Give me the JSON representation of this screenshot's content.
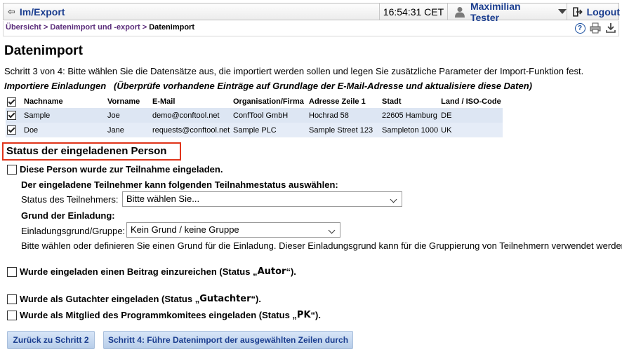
{
  "topbar": {
    "section_label": "Im/Export",
    "time": "16:54:31 CET",
    "user_name": "Maximilian Tester",
    "logout_label": "Logout"
  },
  "breadcrumb": {
    "items": [
      "Übersicht",
      "Datenimport und -export"
    ],
    "sep": ">",
    "current": "Datenimport"
  },
  "page": {
    "title": "Datenimport",
    "step_text": "Schritt 3 von 4: Bitte wählen Sie die Datensätze aus, die importiert werden sollen und legen Sie zusätzliche Parameter der Import-Funktion fest.",
    "import_title": "Importiere Einladungen   (Überprüfe vorhandene Einträge auf Grundlage der E-Mail-Adresse und aktualisiere diese Daten)"
  },
  "table": {
    "headers": [
      "Nachname",
      "Vorname",
      "E-Mail",
      "Organisation/Firma",
      "Adresse Zeile 1",
      "Stadt",
      "Land / ISO-Code"
    ],
    "rows": [
      {
        "checked": true,
        "cells": [
          "Sample",
          "Joe",
          "demo@conftool.net",
          "ConfTool GmbH",
          "Hochrad 58",
          "22605 Hamburg",
          "DE"
        ]
      },
      {
        "checked": true,
        "cells": [
          "Doe",
          "Jane",
          "requests@conftool.net",
          "Sample PLC",
          "Sample Street 123",
          "Sampleton 1000",
          "UK"
        ]
      }
    ]
  },
  "status": {
    "heading": "Status der eingeladenen Person",
    "invited_participation": "Diese Person wurde zur Teilnahme eingeladen.",
    "participant_choose_text": "Der eingeladene Teilnehmer kann folgenden Teilnahmestatus auswählen:",
    "participant_status_label": "Status des Teilnehmers:",
    "participant_status_value": "Bitte wählen Sie...",
    "reason_heading": "Grund der Einladung:",
    "reason_label": "Einladungsgrund/Gruppe:",
    "reason_value": "Kein Grund / keine Gruppe",
    "reason_help": "Bitte wählen oder definieren Sie einen Grund für die Einladung. Dieser Einladungsgrund kann für die Gruppierung von Teilnehmern verwendet werden.",
    "author_prefix": "Wurde eingeladen einen Beitrag einzureichen (Status „",
    "author_role": "Autor",
    "author_suffix": "“).",
    "reviewer_prefix": "Wurde als Gutachter eingeladen (Status „",
    "reviewer_role": "Gutachter",
    "reviewer_suffix": "“).",
    "pc_prefix": "Wurde als Mitglied des Programmkomitees eingeladen (Status „",
    "pc_role": "PK",
    "pc_suffix": "“)."
  },
  "buttons": {
    "back": "Zurück zu Schritt 2",
    "next": "Schritt 4: Führe Datenimport der ausgewählten Zeilen durch"
  },
  "icons": [
    "arrow-left-icon",
    "user-icon",
    "chevron-down-icon",
    "logout-icon",
    "help-icon",
    "print-icon",
    "download-icon",
    "checkbox-icon"
  ],
  "colors": {
    "link": "#1a3d8f",
    "crumb": "#5a2c7a",
    "row_bg": "#dde6f3",
    "highlight_border": "#e0341a",
    "button_bg": "#c5d8f0"
  }
}
